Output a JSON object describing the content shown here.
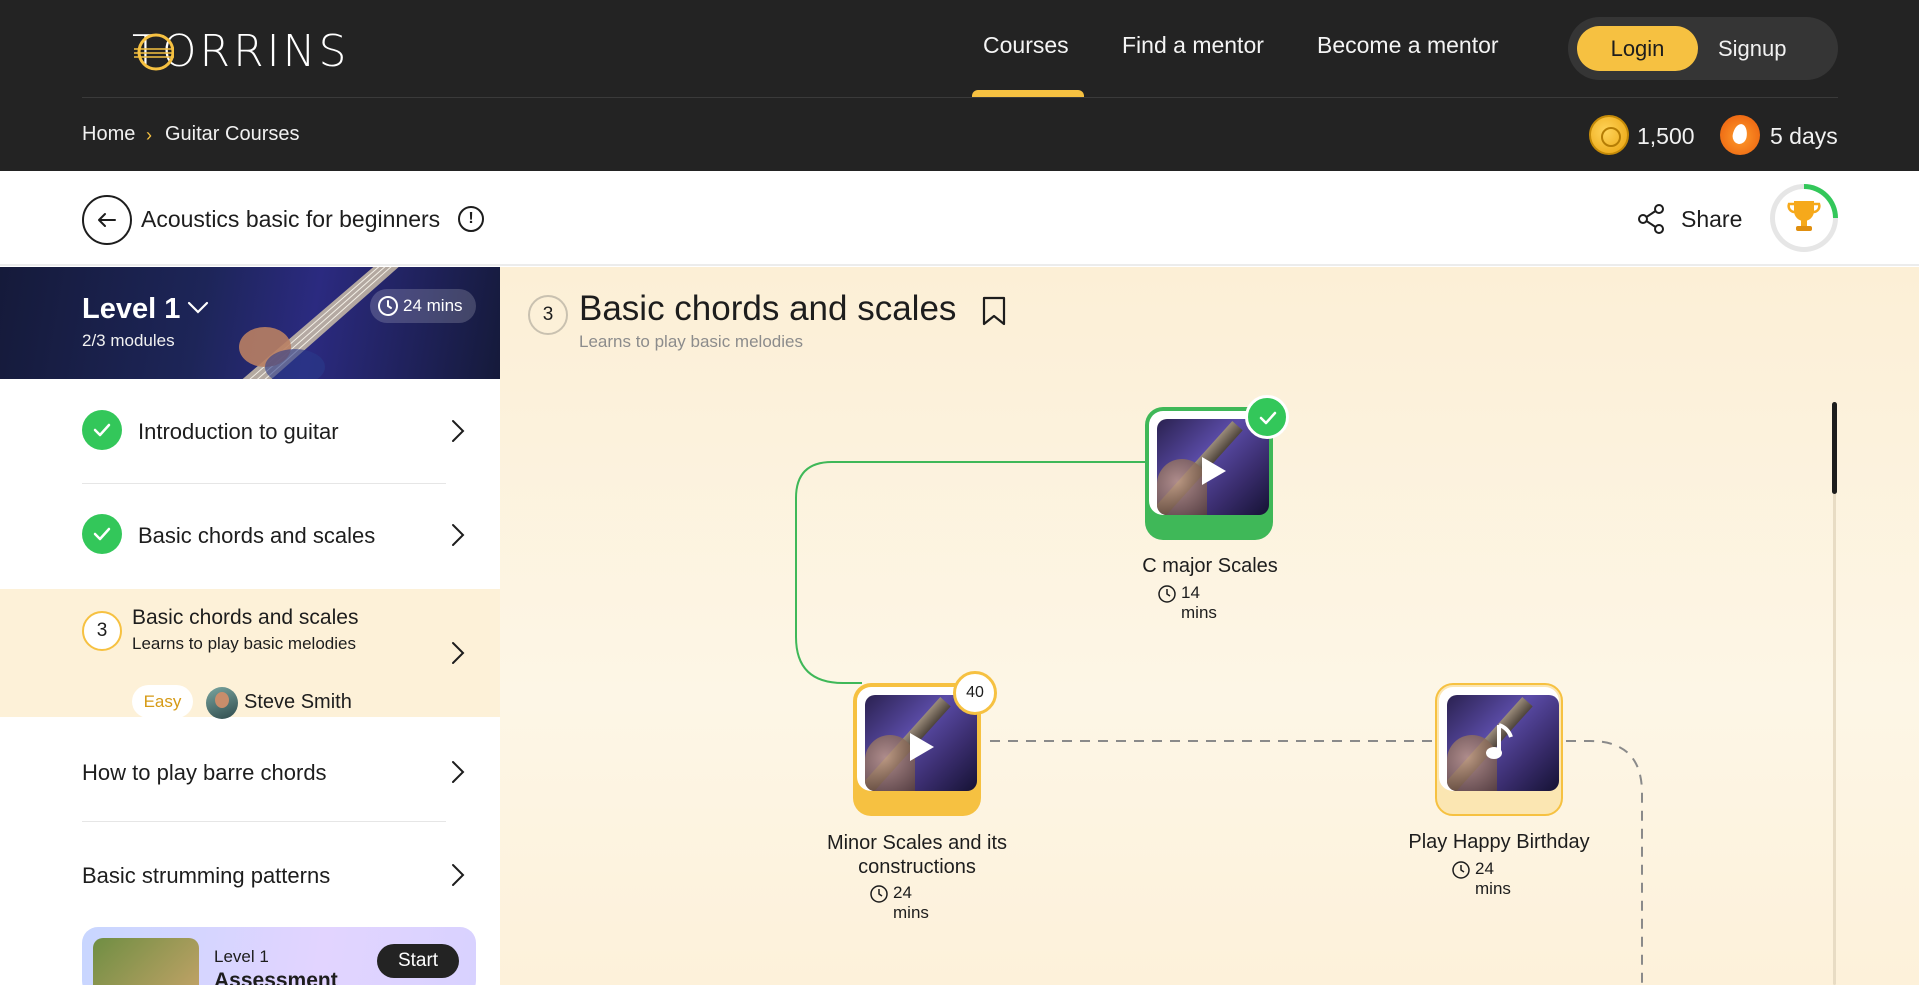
{
  "header": {
    "brand": "TORRINS",
    "nav": [
      {
        "label": "Courses",
        "active": true
      },
      {
        "label": "Find a mentor"
      },
      {
        "label": "Become a mentor"
      }
    ],
    "login_label": "Login",
    "signup_label": "Signup",
    "breadcrumb": [
      "Home",
      "Guitar Courses"
    ],
    "coins": "1,500",
    "streak": "5 days",
    "accent_color": "#f6c141"
  },
  "course": {
    "title": "Acoustics basic for beginners",
    "share_label": "Share",
    "progress_fraction": 0.25
  },
  "sidebar": {
    "level": {
      "title": "Level 1",
      "modules": "2/3 modules",
      "duration": "24 mins"
    },
    "items": [
      {
        "label": "Introduction to guitar",
        "completed": true
      },
      {
        "label": "Basic chords and scales",
        "completed": true
      },
      {
        "number": "3",
        "label": "Basic chords and scales",
        "subtitle": "Learns to play basic melodies",
        "difficulty": "Easy",
        "author": "Steve Smith",
        "active": true
      },
      {
        "label": "How to play barre chords"
      },
      {
        "label": "Basic strumming patterns"
      }
    ],
    "assessment": {
      "level": "Level 1",
      "title": "Assessment",
      "action": "Start"
    }
  },
  "main": {
    "number": "3",
    "title": "Basic chords and scales",
    "subtitle": "Learns to play basic melodies",
    "nodes": [
      {
        "label": "C major Scales",
        "time": "14 mins",
        "status": "completed"
      },
      {
        "label": "Minor Scales and its constructions",
        "time": "24 mins",
        "status": "in-progress",
        "score": "40"
      },
      {
        "label": "Play Happy Birthday",
        "time": "24 mins",
        "status": "locked"
      }
    ]
  }
}
